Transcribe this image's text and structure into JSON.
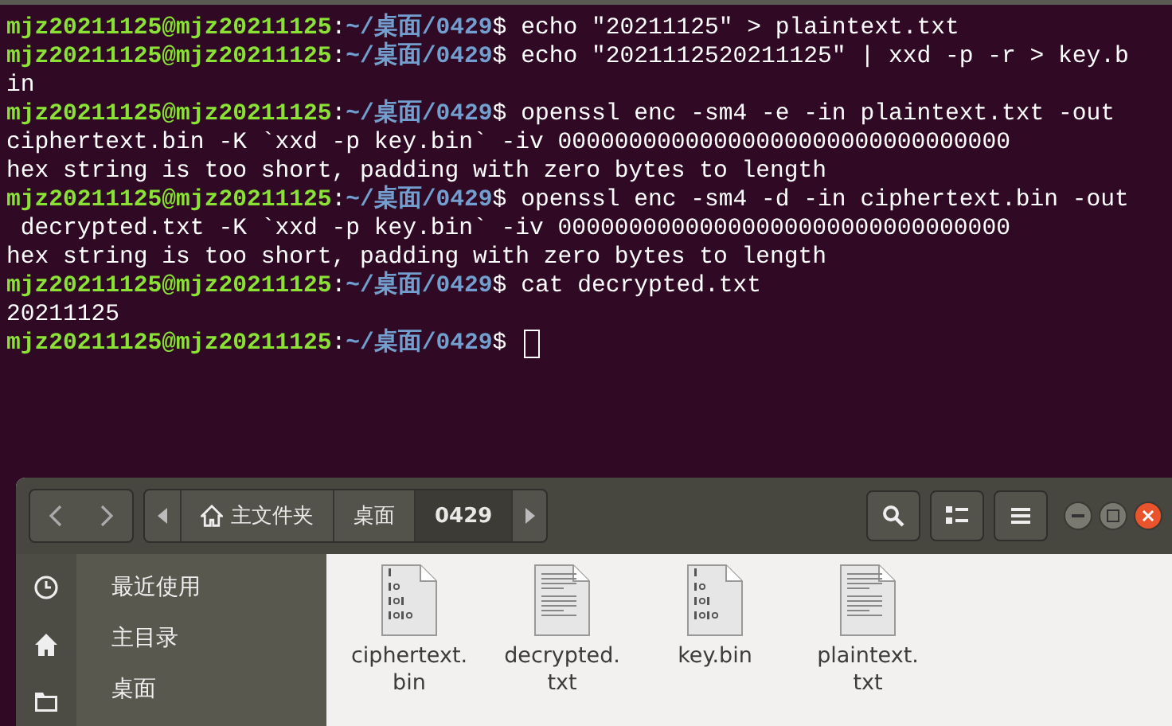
{
  "terminal": {
    "lines": [
      {
        "kind": "prompt",
        "user": "mjz20211125@mjz20211125",
        "sep": ":",
        "path": "~/桌面/0429",
        "symbol": "$",
        "command": "echo \"20211125\" > plaintext.txt"
      },
      {
        "kind": "prompt",
        "user": "mjz20211125@mjz20211125",
        "sep": ":",
        "path": "~/桌面/0429",
        "symbol": "$",
        "command": "echo \"2021112520211125\" | xxd -p -r > key.b"
      },
      {
        "kind": "output",
        "text": "in"
      },
      {
        "kind": "prompt",
        "user": "mjz20211125@mjz20211125",
        "sep": ":",
        "path": "~/桌面/0429",
        "symbol": "$",
        "command": "openssl enc -sm4 -e -in plaintext.txt -out"
      },
      {
        "kind": "output",
        "text": "ciphertext.bin -K `xxd -p key.bin` -iv 00000000000000000000000000000000"
      },
      {
        "kind": "output",
        "text": "hex string is too short, padding with zero bytes to length"
      },
      {
        "kind": "prompt",
        "user": "mjz20211125@mjz20211125",
        "sep": ":",
        "path": "~/桌面/0429",
        "symbol": "$",
        "command": "openssl enc -sm4 -d -in ciphertext.bin -out"
      },
      {
        "kind": "output",
        "text": " decrypted.txt -K `xxd -p key.bin` -iv 00000000000000000000000000000000"
      },
      {
        "kind": "output",
        "text": "hex string is too short, padding with zero bytes to length"
      },
      {
        "kind": "prompt",
        "user": "mjz20211125@mjz20211125",
        "sep": ":",
        "path": "~/桌面/0429",
        "symbol": "$",
        "command": "cat decrypted.txt"
      },
      {
        "kind": "output",
        "text": "20211125"
      },
      {
        "kind": "prompt",
        "user": "mjz20211125@mjz20211125",
        "sep": ":",
        "path": "~/桌面/0429",
        "symbol": "$",
        "cursor": true
      }
    ]
  },
  "file_manager": {
    "breadcrumb": [
      {
        "label": "主文件夹",
        "home": true,
        "selected": false
      },
      {
        "label": "桌面",
        "home": false,
        "selected": false
      },
      {
        "label": "0429",
        "home": false,
        "selected": true
      }
    ],
    "sidebar": [
      {
        "label": "最近使用",
        "kind": "recent"
      },
      {
        "label": "主目录",
        "kind": "home"
      },
      {
        "label": "桌面",
        "kind": "desktop"
      }
    ],
    "files": [
      {
        "name": "ciphertext.\nbin",
        "kind": "binary"
      },
      {
        "name": "decrypted.\ntxt",
        "kind": "text"
      },
      {
        "name": "key.bin",
        "kind": "binary"
      },
      {
        "name": "plaintext.\ntxt",
        "kind": "text"
      }
    ]
  }
}
